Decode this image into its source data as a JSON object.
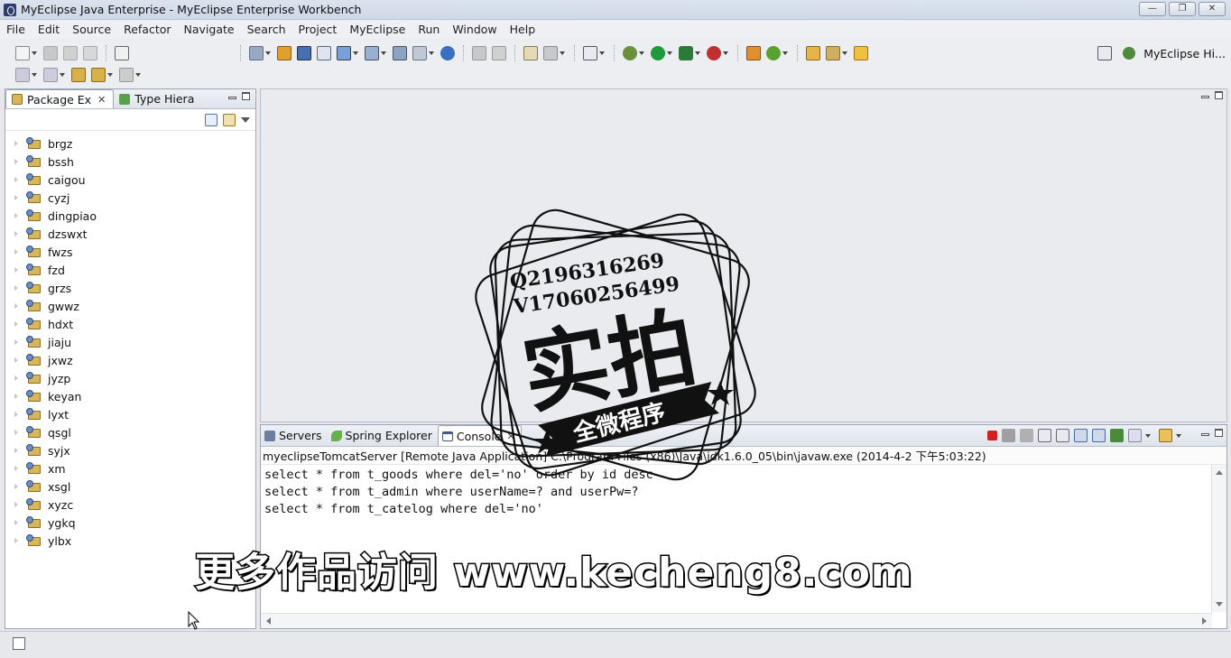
{
  "window": {
    "title": "MyEclipse Java Enterprise - MyEclipse Enterprise Workbench",
    "controls": [
      "—",
      "❐",
      "✕"
    ]
  },
  "menu": [
    "File",
    "Edit",
    "Source",
    "Refactor",
    "Navigate",
    "Search",
    "Project",
    "MyEclipse",
    "Run",
    "Window",
    "Help"
  ],
  "perspective": {
    "label": "MyEclipse Hi..."
  },
  "left_panel": {
    "tabs": [
      {
        "label": "Package Ex",
        "close": "✕"
      },
      {
        "label": "Type Hiera"
      }
    ],
    "projects": [
      "brgz",
      "bssh",
      "caigou",
      "cyzj",
      "dingpiao",
      "dzswxt",
      "fwzs",
      "fzd",
      "grzs",
      "gwwz",
      "hdxt",
      "jiaju",
      "jxwz",
      "jyzp",
      "keyan",
      "lyxt",
      "qsgl",
      "syjx",
      "xm",
      "xsgl",
      "xyzc",
      "ygkq",
      "ylbx"
    ]
  },
  "console_panel": {
    "tabs": [
      {
        "label": "Servers"
      },
      {
        "label": "Spring Explorer"
      },
      {
        "label": "Console",
        "close": "✕"
      }
    ],
    "process_line": "myeclipseTomcatServer [Remote Java Application] C:\\Program Files (x86)\\Java\\jdk1.6.0_05\\bin\\javaw.exe (2014-4-2 下午5:03:22)",
    "lines": [
      "select * from t_goods where del='no' order by id desc",
      "select * from t_admin where userName=? and userPw=?",
      "select * from t_catelog where del='no'"
    ]
  },
  "watermark": {
    "contact_q": "Q2196316269",
    "contact_v": "V17060256499",
    "big": "实拍",
    "ribbon": "全微程序",
    "promo": "更多作品访问 www.kecheng8.com"
  }
}
